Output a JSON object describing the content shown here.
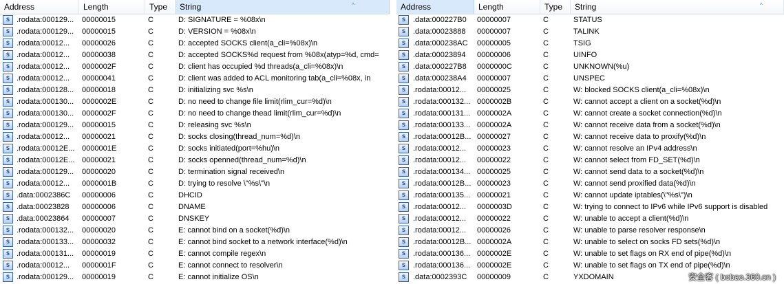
{
  "columns": {
    "address": "Address",
    "length": "Length",
    "type": "Type",
    "string": "String"
  },
  "icon": "string-entry-icon",
  "watermark": "安全客 ( bobao.360.cn )",
  "left_rows": [
    {
      "address": ".rodata:000129...",
      "length": "00000015",
      "type": "C",
      "string": "D: SIGNATURE = %08x\\n"
    },
    {
      "address": ".rodata:000129...",
      "length": "00000015",
      "type": "C",
      "string": "D: VERSION   = %08x\\n"
    },
    {
      "address": ".rodata:00012...",
      "length": "00000026",
      "type": "C",
      "string": "D: accepted SOCKS client(a_cli=%08x)\\n"
    },
    {
      "address": ".rodata:00012...",
      "length": "00000038",
      "type": "C",
      "string": "D: accepted SOCKS%d request from %08x(atyp=%d, cmd="
    },
    {
      "address": ".rodata:00012...",
      "length": "0000002F",
      "type": "C",
      "string": "D: client has occupied %d threads(a_cli=%08x)\\n"
    },
    {
      "address": ".rodata:00012...",
      "length": "00000041",
      "type": "C",
      "string": "D: client was added to ACL monitoring tab(a_cli=%08x, in"
    },
    {
      "address": ".rodata:000128...",
      "length": "00000018",
      "type": "C",
      "string": "D: initializing svc %s\\n"
    },
    {
      "address": ".rodata:000130...",
      "length": "0000002E",
      "type": "C",
      "string": "D: no need to change file limit(rlim_cur=%d)\\n"
    },
    {
      "address": ".rodata:000130...",
      "length": "0000002F",
      "type": "C",
      "string": "D: no need to change thead limit(rlim_cur=%d)\\n"
    },
    {
      "address": ".rodata:000129...",
      "length": "00000015",
      "type": "C",
      "string": "D: releasing svc %s\\n"
    },
    {
      "address": ".rodata:00012...",
      "length": "00000021",
      "type": "C",
      "string": "D: socks closing(thread_num=%d)\\n"
    },
    {
      "address": ".rodata:00012E...",
      "length": "0000001E",
      "type": "C",
      "string": "D: socks initiated(port=%hu)\\n"
    },
    {
      "address": ".rodata:00012E...",
      "length": "00000021",
      "type": "C",
      "string": "D: socks openned(thread_num=%d)\\n"
    },
    {
      "address": ".rodata:000129...",
      "length": "00000020",
      "type": "C",
      "string": "D: termination signal received\\n"
    },
    {
      "address": ".rodata:00012...",
      "length": "0000001B",
      "type": "C",
      "string": "D: trying to resolve \\\"%s\\\"\\n"
    },
    {
      "address": ".data:0002386C",
      "length": "00000006",
      "type": "C",
      "string": "DHCID"
    },
    {
      "address": ".data:00023828",
      "length": "00000006",
      "type": "C",
      "string": "DNAME"
    },
    {
      "address": ".data:00023864",
      "length": "00000007",
      "type": "C",
      "string": "DNSKEY"
    },
    {
      "address": ".rodata:000132...",
      "length": "00000020",
      "type": "C",
      "string": "E: cannot bind on a socket(%d)\\n"
    },
    {
      "address": ".rodata:000133...",
      "length": "00000032",
      "type": "C",
      "string": "E: cannot bind socket to a network interface(%d)\\n"
    },
    {
      "address": ".rodata:000131...",
      "length": "00000019",
      "type": "C",
      "string": "E: cannot compile regex\\n"
    },
    {
      "address": ".rodata:00012...",
      "length": "0000001F",
      "type": "C",
      "string": "E: cannot connect to resolver\\n"
    },
    {
      "address": ".rodata:000129...",
      "length": "00000019",
      "type": "C",
      "string": "E: cannot initialize OS\\n"
    }
  ],
  "right_rows": [
    {
      "address": ".data:000227B0",
      "length": "00000007",
      "type": "C",
      "string": "STATUS"
    },
    {
      "address": ".data:00023888",
      "length": "00000007",
      "type": "C",
      "string": "TALINK"
    },
    {
      "address": ".data:000238AC",
      "length": "00000005",
      "type": "C",
      "string": "TSIG"
    },
    {
      "address": ".data:00023894",
      "length": "00000006",
      "type": "C",
      "string": "UINFO"
    },
    {
      "address": ".data:000227B8",
      "length": "0000000C",
      "type": "C",
      "string": "UNKNOWN(%u)"
    },
    {
      "address": ".data:000238A4",
      "length": "00000007",
      "type": "C",
      "string": "UNSPEC"
    },
    {
      "address": ".rodata:00012...",
      "length": "00000025",
      "type": "C",
      "string": "W: blocked SOCKS client(a_cli=%08x)\\n"
    },
    {
      "address": ".rodata:000132...",
      "length": "0000002B",
      "type": "C",
      "string": "W: cannot accept a client on a socket(%d)\\n"
    },
    {
      "address": ".rodata:000131...",
      "length": "0000002A",
      "type": "C",
      "string": "W: cannot create a socket connection(%d)\\n"
    },
    {
      "address": ".rodata:000133...",
      "length": "0000002A",
      "type": "C",
      "string": "W: cannot receive data from a socket(%d)\\n"
    },
    {
      "address": ".rodata:00012B...",
      "length": "00000027",
      "type": "C",
      "string": "W: cannot receive data to proxify(%d)\\n"
    },
    {
      "address": ".rodata:00012...",
      "length": "00000023",
      "type": "C",
      "string": "W: cannot resolve an IPv4 address\\n"
    },
    {
      "address": ".rodata:00012...",
      "length": "00000022",
      "type": "C",
      "string": "W: cannot select from FD_SET(%d)\\n"
    },
    {
      "address": ".rodata:000134...",
      "length": "00000025",
      "type": "C",
      "string": "W: cannot send data to a socket(%d)\\n"
    },
    {
      "address": ".rodata:00012B...",
      "length": "00000023",
      "type": "C",
      "string": "W: cannot send proxified data(%d)\\n"
    },
    {
      "address": ".rodata:000135...",
      "length": "00000021",
      "type": "C",
      "string": "W: cannot update iptables(\\\"%s\\\")\\n"
    },
    {
      "address": ".rodata:00012...",
      "length": "0000003D",
      "type": "C",
      "string": "W: trying to connect to IPv6 while IPv6 support is disabled"
    },
    {
      "address": ".rodata:00012...",
      "length": "00000022",
      "type": "C",
      "string": "W: unable to accept a client(%d)\\n"
    },
    {
      "address": ".rodata:00012...",
      "length": "00000026",
      "type": "C",
      "string": "W: unable to parse resolver response\\n"
    },
    {
      "address": ".rodata:00012B...",
      "length": "0000002A",
      "type": "C",
      "string": "W: unable to select on socks FD sets(%d)\\n"
    },
    {
      "address": ".rodata:000136...",
      "length": "0000002E",
      "type": "C",
      "string": "W: unable to set flags on RX end of pipe(%d)\\n"
    },
    {
      "address": ".rodata:000136...",
      "length": "0000002E",
      "type": "C",
      "string": "W: unable to set flags on TX end of pipe(%d)\\n"
    },
    {
      "address": ".data:0002393C",
      "length": "00000009",
      "type": "C",
      "string": "YXDOMAIN"
    }
  ]
}
